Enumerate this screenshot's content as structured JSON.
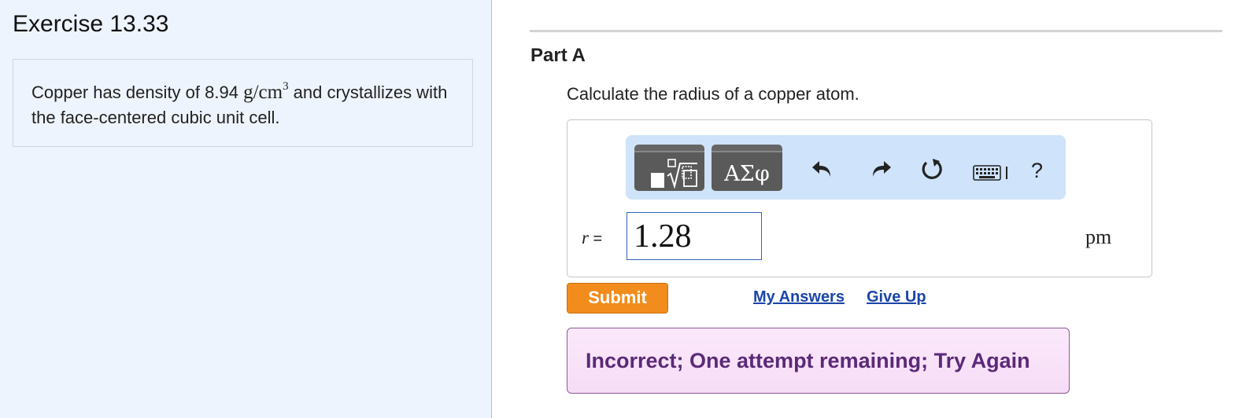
{
  "exercise": {
    "title": "Exercise 13.33",
    "problem_text_before": "Copper has density of 8.94 ",
    "problem_units_base": "g/cm",
    "problem_units_exp": "3",
    "problem_text_after": " and crystallizes with the face-centered cubic unit cell."
  },
  "part": {
    "title": "Part A",
    "question": "Calculate the radius of a copper atom."
  },
  "toolbar": {
    "greek_label": "ΑΣφ",
    "help_label": "?",
    "icons": [
      "templates-icon",
      "undo-icon",
      "redo-icon",
      "reset-icon",
      "keyboard-icon",
      "help-icon"
    ]
  },
  "answer": {
    "variable": "r",
    "equals": "=",
    "value": "1.28",
    "unit": "pm"
  },
  "actions": {
    "submit_label": "Submit",
    "my_answers_label": "My Answers",
    "give_up_label": "Give Up"
  },
  "feedback": {
    "message": "Incorrect; One attempt remaining; Try Again"
  },
  "colors": {
    "left_panel_bg": "#eef4fd",
    "toolbar_bg": "#cfe3fa",
    "submit_bg": "#f28c1c",
    "link": "#1b45a8",
    "feedback_text": "#5b2a78",
    "feedback_bg": "#f6dcf6",
    "input_border": "#2f64b9"
  }
}
